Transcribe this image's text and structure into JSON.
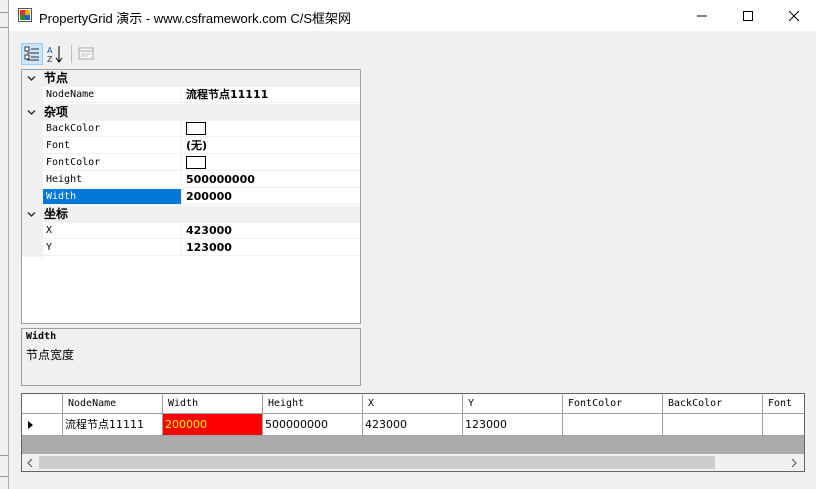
{
  "window": {
    "title": "PropertyGrid 演示 - www.csframework.com C/S框架网"
  },
  "toolbar": {
    "categorized_icon": "categorized-icon",
    "alphabetical_icon": "alphabetical-icon",
    "property_pages_icon": "property-pages-icon"
  },
  "property_grid": {
    "categories": [
      {
        "label": "节点",
        "items": [
          {
            "name": "NodeName",
            "value": "流程节点11111"
          }
        ]
      },
      {
        "label": "杂项",
        "items": [
          {
            "name": "BackColor",
            "value": ""
          },
          {
            "name": "Font",
            "value": "(无)"
          },
          {
            "name": "FontColor",
            "value": ""
          },
          {
            "name": "Height",
            "value": "500000000"
          },
          {
            "name": "Width",
            "value": "200000"
          }
        ]
      },
      {
        "label": "坐标",
        "items": [
          {
            "name": "X",
            "value": "423000"
          },
          {
            "name": "Y",
            "value": "123000"
          }
        ]
      }
    ],
    "selected": "Width",
    "swatch_color": "#ffffff",
    "selection_color": "#0078d7"
  },
  "description": {
    "title": "Width",
    "text": "节点宽度"
  },
  "data_grid": {
    "columns": [
      "NodeName",
      "Width",
      "Height",
      "X",
      "Y",
      "FontColor",
      "BackColor",
      "Font"
    ],
    "rows": [
      {
        "cells": [
          "流程节点11111",
          "200000",
          "500000000",
          "423000",
          "123000",
          "",
          "",
          ""
        ]
      }
    ],
    "highlight_background": "#ff0000",
    "highlight_text": "#ffff00"
  }
}
